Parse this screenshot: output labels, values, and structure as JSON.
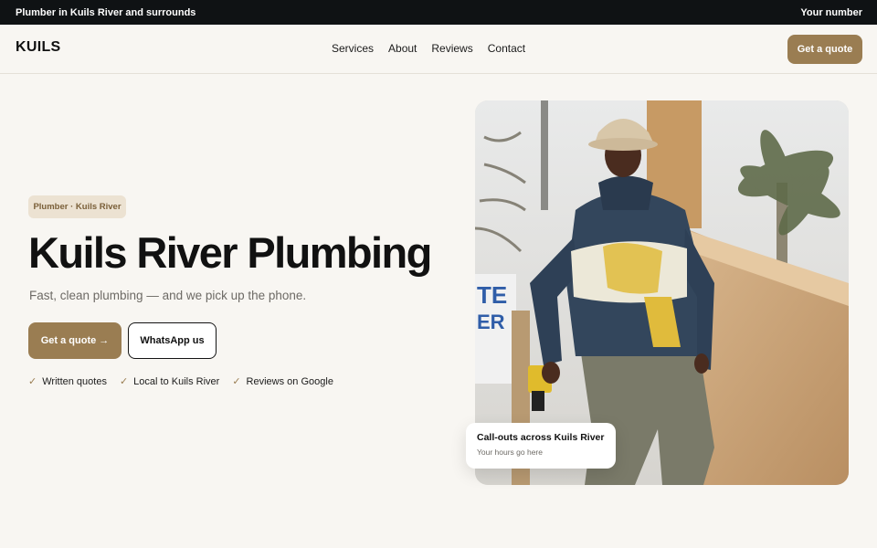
{
  "topbar": {
    "tagline": "Plumber in Kuils River and surrounds",
    "phone": "Your number"
  },
  "header": {
    "logo": "KUILS",
    "nav": [
      "Services",
      "About",
      "Reviews",
      "Contact"
    ],
    "cta": "Get a quote"
  },
  "hero": {
    "badge": "Plumber · Kuils River",
    "title": "Kuils River Plumbing",
    "subtitle": "Fast, clean plumbing — and we pick up the phone.",
    "primary_cta": "Get a quote →",
    "secondary_cta": "WhatsApp us",
    "checks": [
      "Written quotes",
      "Local to Kuils River",
      "Reviews on Google"
    ],
    "check_icon": "check-icon"
  },
  "callout": {
    "title": "Call-outs across Kuils River",
    "subtitle": "Your hours go here"
  },
  "colors": {
    "accent": "#9a7d52",
    "topbar": "#0f1214",
    "background": "#f8f6f2",
    "badge_bg": "#ece2d2"
  }
}
